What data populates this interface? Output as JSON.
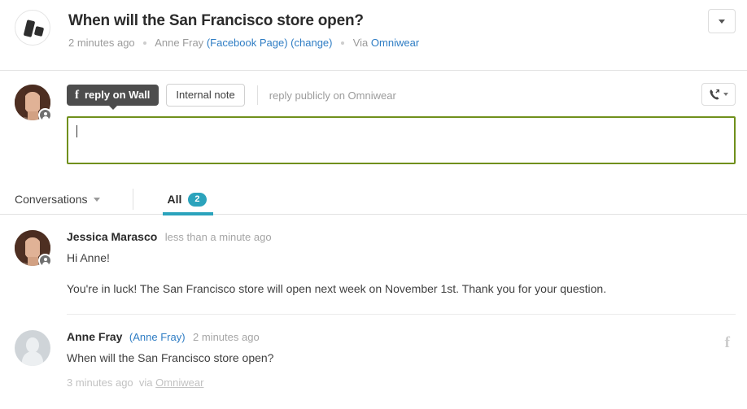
{
  "header": {
    "logo_icon": "omniwear-logo-icon",
    "title": "When will the San Francisco store open?",
    "meta": {
      "time": "2 minutes ago",
      "author": "Anne Fray",
      "channel": "(Facebook Page)",
      "change_link": "(change)",
      "via_prefix": "Via",
      "via_source": "Omniwear"
    },
    "dropdown_icon": "chevron-down-icon"
  },
  "composer": {
    "avatar_name": "agent-avatar",
    "tabs": [
      {
        "label": "reply on Wall",
        "icon": "facebook-f-icon",
        "active": true
      },
      {
        "label": "Internal note",
        "active": false
      }
    ],
    "hint": "reply publicly on Omniwear",
    "call_button_icon": "phone-forward-icon",
    "call_button_caret": "caret-down-icon",
    "textarea_value": "",
    "textarea_placeholder": ""
  },
  "filterbar": {
    "conversations_label": "Conversations",
    "conversations_caret": "chevron-down-icon",
    "tab_all_label": "All",
    "tab_all_count": "2",
    "accent_color": "#2ba3bc"
  },
  "messages": [
    {
      "author": "Jessica Marasco",
      "alias": "",
      "time": "less than a minute ago",
      "paragraphs": [
        "Hi Anne!",
        "You're in luck! The San Francisco store will open next week on November 1st. Thank you for your question."
      ],
      "footer": "",
      "avatar_type": "photo",
      "channel_icon": ""
    },
    {
      "author": "Anne Fray",
      "alias": "(Anne Fray)",
      "time": "2 minutes ago",
      "paragraphs": [
        "When will the San Francisco store open?"
      ],
      "footer_time": "3 minutes ago",
      "footer_via": "via",
      "footer_source": "Omniwear",
      "avatar_type": "placeholder",
      "channel_icon": "facebook-f-icon"
    }
  ],
  "colors": {
    "accent_teal": "#2ba3bc",
    "link_blue": "#2f7dc4",
    "composer_border_green": "#70901c",
    "active_tab_dark": "#4d4d4d"
  }
}
